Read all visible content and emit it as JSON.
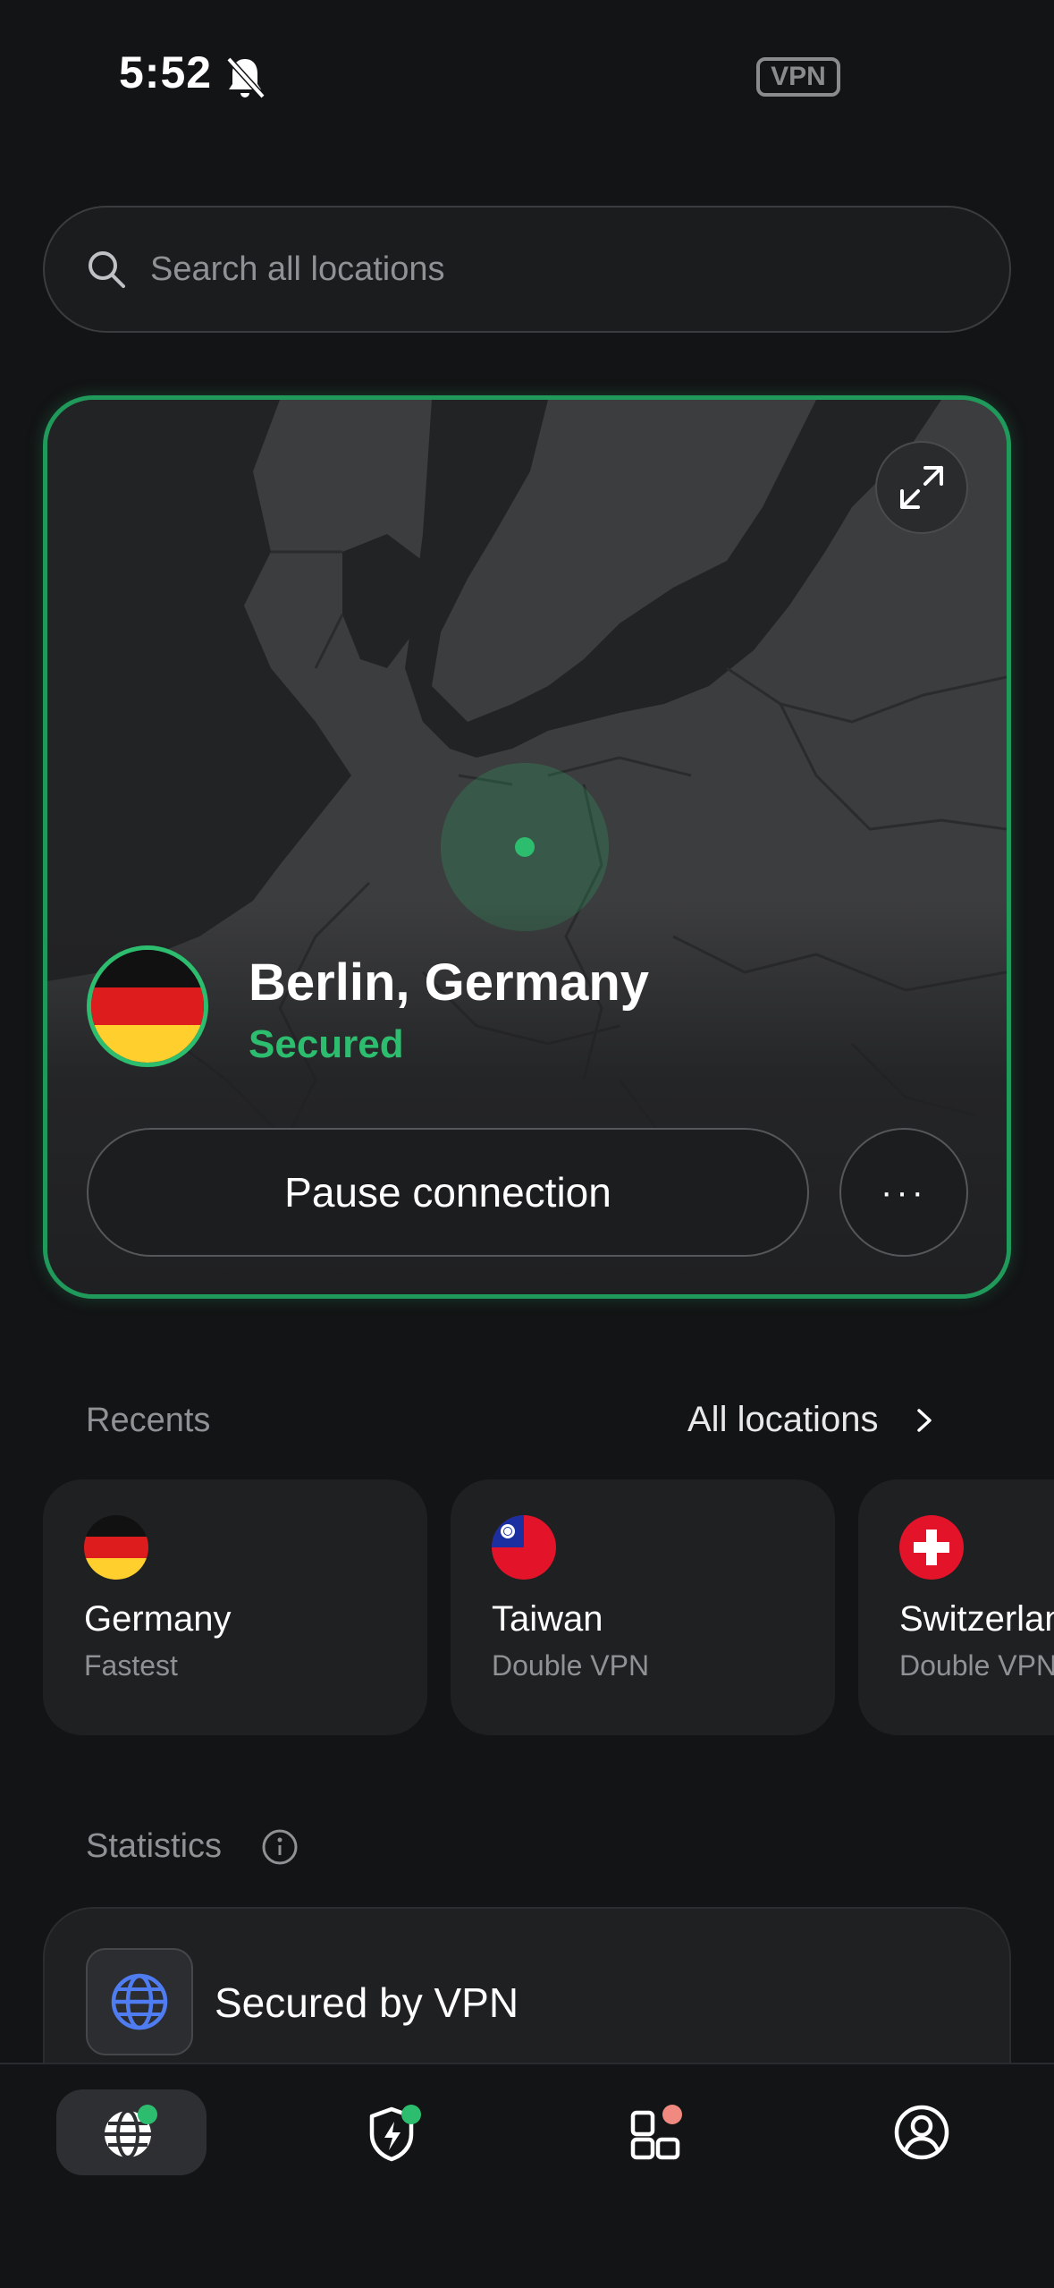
{
  "status_bar": {
    "time": "5:52",
    "vpn_badge": "VPN"
  },
  "search": {
    "placeholder": "Search all locations"
  },
  "connection": {
    "city": "Berlin, Germany",
    "status": "Secured",
    "pause_label": "Pause connection",
    "more_label": "···"
  },
  "recents": {
    "title": "Recents",
    "all_locations_label": "All locations",
    "items": [
      {
        "name": "Germany",
        "sub": "Fastest"
      },
      {
        "name": "Taiwan",
        "sub": "Double VPN"
      },
      {
        "name": "Switzerland",
        "sub": "Double VPN"
      }
    ]
  },
  "statistics": {
    "title": "Statistics",
    "card_label": "Secured by VPN"
  },
  "colors": {
    "accent": "#2dbd6e",
    "globe": "#4f7cf0",
    "apps_dot": "#f08a80"
  },
  "icons": [
    "bell-off-icon",
    "search-icon",
    "expand-icon",
    "more-icon",
    "chevron-right-icon",
    "info-icon",
    "globe-icon",
    "shield-bolt-icon",
    "apps-icon",
    "profile-icon"
  ]
}
